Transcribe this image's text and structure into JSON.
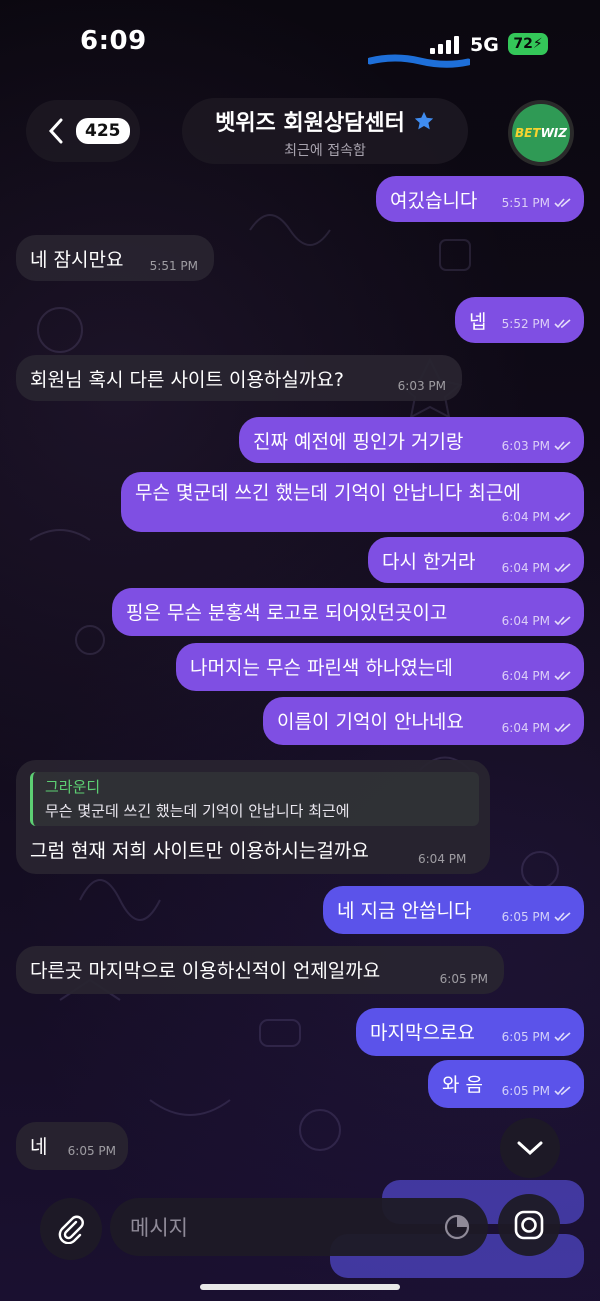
{
  "status_bar": {
    "time": "6:09",
    "network": "5G",
    "battery": "72"
  },
  "header": {
    "unread_count": "425",
    "title": "벳위즈 회원상담센터",
    "subtitle": "최근에 접속함",
    "avatar_text_a": "BET",
    "avatar_text_b": "WIZ"
  },
  "messages": [
    {
      "side": "out",
      "text": "여깄습니다",
      "time": "5:51 PM"
    },
    {
      "side": "in",
      "text": "네 잠시만요",
      "time": "5:51 PM"
    },
    {
      "side": "out",
      "text": "넵",
      "time": "5:52 PM"
    },
    {
      "side": "in",
      "text": "회원님 혹시 다른 사이트 이용하실까요?",
      "time": "6:03 PM"
    },
    {
      "side": "out",
      "text": "진짜 예전에 핑인가 거기랑",
      "time": "6:03 PM"
    },
    {
      "side": "out",
      "text": "무슨 몇군데 쓰긴 했는데 기억이 안납니다 최근에",
      "time": "6:04 PM"
    },
    {
      "side": "out",
      "text": "다시 한거라",
      "time": "6:04 PM"
    },
    {
      "side": "out",
      "text": "핑은 무슨 분홍색 로고로 되어있던곳이고",
      "time": "6:04 PM"
    },
    {
      "side": "out",
      "text": "나머지는 무슨 파린색 하나였는데",
      "time": "6:04 PM"
    },
    {
      "side": "out",
      "text": "이름이 기억이 안나네요",
      "time": "6:04 PM"
    },
    {
      "side": "in",
      "reply_name": "그라운디",
      "reply_text": "무슨 몇군데 쓰긴 했는데 기억이 안납니다 최근에",
      "text": "그럼 현재 저희 사이트만 이용하시는걸까요",
      "time": "6:04 PM"
    },
    {
      "side": "out",
      "text": "네 지금 안씁니다",
      "time": "6:05 PM"
    },
    {
      "side": "in",
      "text": "다른곳 마지막으로 이용하신적이 언제일까요",
      "time": "6:05 PM"
    },
    {
      "side": "out",
      "text": "마지막으로요",
      "time": "6:05 PM"
    },
    {
      "side": "out",
      "text": "와 음",
      "time": "6:05 PM"
    },
    {
      "side": "in",
      "text": "네",
      "time": "6:05 PM"
    }
  ],
  "composer": {
    "placeholder": "메시지"
  },
  "colors": {
    "outgoing": "#7f4fe3",
    "outgoing_late": "#5b53ea",
    "incoming": "#28242f",
    "reply_accent": "#5dcf73"
  },
  "icons": [
    "back-chevron-icon",
    "star-icon",
    "read-ticks-icon",
    "chevron-down-icon",
    "paperclip-icon",
    "sticker-icon",
    "camera-icon"
  ]
}
